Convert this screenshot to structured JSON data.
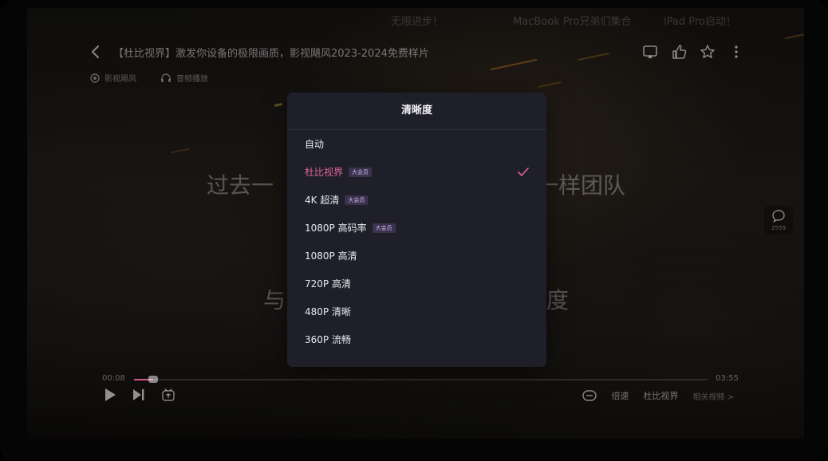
{
  "ticker": [
    "无限进步！",
    "MacBook Pro兄弟们集合",
    "iPad Pro启动！"
  ],
  "header": {
    "title": "【杜比视界】激发你设备的极限画质，影视飓风2023-2024免费样片"
  },
  "meta": {
    "author": "影视飓风",
    "audio_mode": "音频播放"
  },
  "subtitles": {
    "line1_left": "过去一",
    "line1_right": "一样团队",
    "line2_left": "与",
    "line2_right": "度"
  },
  "comments": {
    "count": "2559"
  },
  "player": {
    "current_time": "00:08",
    "total_time": "03:55",
    "progress_fraction": 0.034,
    "speed_label": "倍速",
    "quality_label": "杜比视界",
    "related_label": "相关视频 >"
  },
  "quality_modal": {
    "title": "清晰度",
    "selected_index": 1,
    "options": [
      {
        "label": "自动",
        "badge": ""
      },
      {
        "label": "杜比视界",
        "badge": "大会员"
      },
      {
        "label": "4K 超清",
        "badge": "大会员"
      },
      {
        "label": "1080P 高码率",
        "badge": "大会员"
      },
      {
        "label": "1080P 高清",
        "badge": ""
      },
      {
        "label": "720P 高清",
        "badge": ""
      },
      {
        "label": "480P 清晰",
        "badge": ""
      },
      {
        "label": "360P 流畅",
        "badge": ""
      }
    ]
  },
  "colors": {
    "accent": "#e0649a",
    "modal_bg": "#1f1f2a"
  }
}
